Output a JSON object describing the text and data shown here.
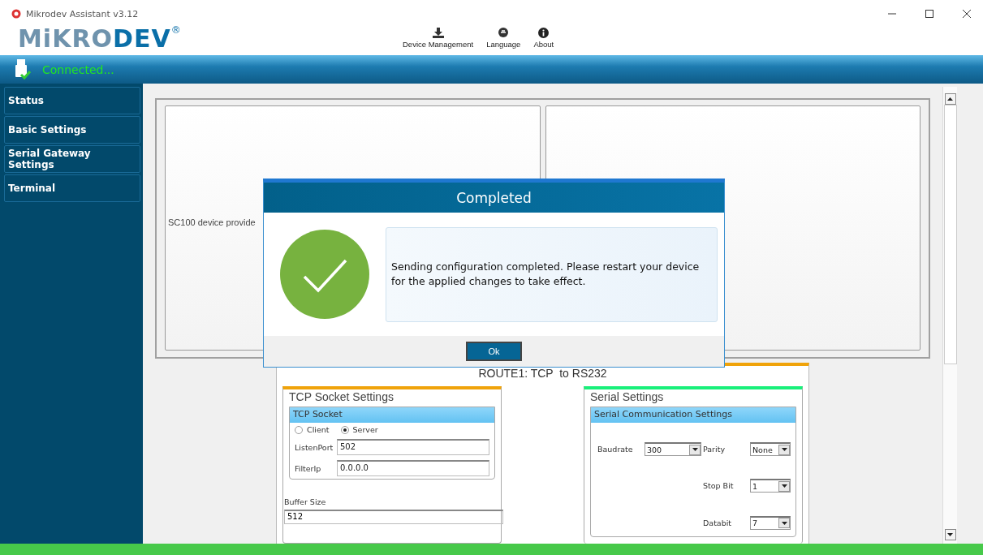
{
  "window": {
    "title": "Mikrodev Assistant v3.12"
  },
  "logo": {
    "part_1": "MiKRO",
    "part_2": "DEV",
    "mark": "®"
  },
  "toolbar": [
    {
      "label": "Device Management",
      "kind": "download"
    },
    {
      "label": "Language",
      "kind": "language"
    },
    {
      "label": "About",
      "kind": "info"
    }
  ],
  "status": {
    "text": "Connected..."
  },
  "sidebar": {
    "items": [
      {
        "label": "Status"
      },
      {
        "label": "Basic Settings"
      },
      {
        "label": "Serial Gateway Settings"
      },
      {
        "label": "Terminal"
      }
    ]
  },
  "info_panel": {
    "text": "SC100 device provide"
  },
  "route": {
    "title": "ROUTE1: TCP  to RS232",
    "tcp": {
      "title": "TCP Socket Settings",
      "group": "TCP Socket",
      "modes": [
        {
          "label": "Client",
          "selected": false
        },
        {
          "label": "Server",
          "selected": true
        }
      ],
      "fields": [
        {
          "label": "ListenPort",
          "value": "502"
        },
        {
          "label": "FilterIp",
          "value": "0.0.0.0"
        }
      ],
      "buffer": {
        "label": "Buffer Size",
        "value": "512"
      }
    },
    "serial": {
      "title": "Serial Settings",
      "group": "Serial Communication Settings",
      "baudrate": {
        "label": "Baudrate",
        "value": "300"
      },
      "selects": [
        {
          "label": "Parity",
          "value": "None"
        },
        {
          "label": "Stop Bit",
          "value": "1"
        },
        {
          "label": "Databit",
          "value": "7"
        }
      ]
    }
  },
  "dialog": {
    "title": "Completed",
    "message": "Sending configuration completed. Please restart your device for the applied changes to take effect.",
    "button": "Ok"
  }
}
